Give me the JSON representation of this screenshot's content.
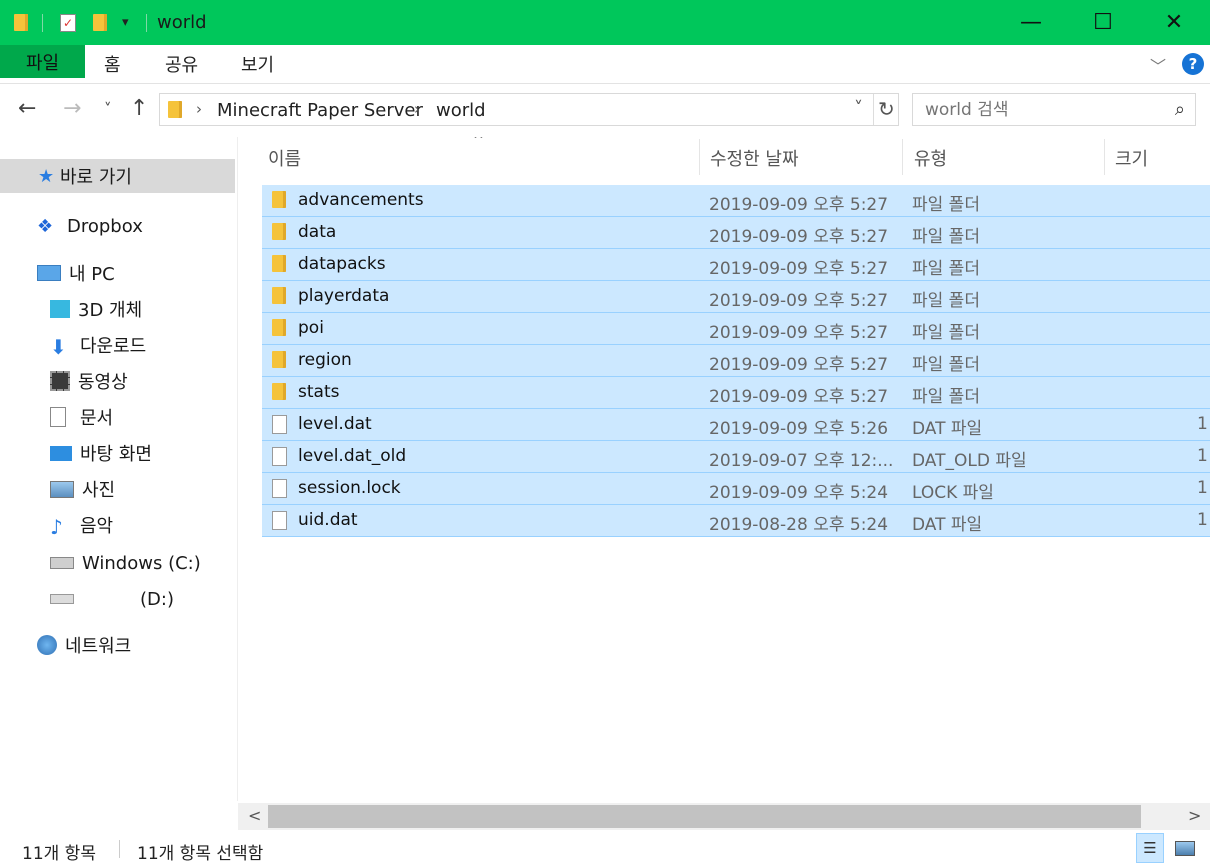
{
  "window": {
    "title": "world",
    "minimize": "—",
    "maximize": "☐",
    "close": "✕",
    "qa_dropdown": "▾"
  },
  "ribbon": {
    "file_tab": "파일",
    "tabs": [
      "홈",
      "공유",
      "보기"
    ],
    "expand": "﹀",
    "help": "?"
  },
  "nav": {
    "back": "←",
    "forward": "→",
    "recent": "˅",
    "up": "↑",
    "breadcrumb": [
      "Minecraft Paper Server",
      "world"
    ],
    "sep": "›",
    "dropdown": "˅",
    "refresh": "↻",
    "search_placeholder": "world 검색",
    "search_icon": "⌕"
  },
  "sidebar": {
    "quick_access": "바로 가기",
    "dropbox": "Dropbox",
    "this_pc": "내 PC",
    "items": [
      "3D 개체",
      "다운로드",
      "동영상",
      "문서",
      "바탕 화면",
      "사진",
      "음악",
      "Windows (C:)",
      "(D:)"
    ],
    "network": "네트워크"
  },
  "columns": {
    "name": "이름",
    "date": "수정한 날짜",
    "type": "유형",
    "size": "크기",
    "sort": "^"
  },
  "files": [
    {
      "name": "advancements",
      "date": "2019-09-09 오후 5:27",
      "type": "파일 폴더",
      "size": "",
      "kind": "folder"
    },
    {
      "name": "data",
      "date": "2019-09-09 오후 5:27",
      "type": "파일 폴더",
      "size": "",
      "kind": "folder"
    },
    {
      "name": "datapacks",
      "date": "2019-09-09 오후 5:27",
      "type": "파일 폴더",
      "size": "",
      "kind": "folder"
    },
    {
      "name": "playerdata",
      "date": "2019-09-09 오후 5:27",
      "type": "파일 폴더",
      "size": "",
      "kind": "folder"
    },
    {
      "name": "poi",
      "date": "2019-09-09 오후 5:27",
      "type": "파일 폴더",
      "size": "",
      "kind": "folder"
    },
    {
      "name": "region",
      "date": "2019-09-09 오후 5:27",
      "type": "파일 폴더",
      "size": "",
      "kind": "folder"
    },
    {
      "name": "stats",
      "date": "2019-09-09 오후 5:27",
      "type": "파일 폴더",
      "size": "",
      "kind": "folder"
    },
    {
      "name": "level.dat",
      "date": "2019-09-09 오후 5:26",
      "type": "DAT 파일",
      "size": "1",
      "kind": "file"
    },
    {
      "name": "level.dat_old",
      "date": "2019-09-07 오후 12:...",
      "type": "DAT_OLD 파일",
      "size": "1",
      "kind": "file"
    },
    {
      "name": "session.lock",
      "date": "2019-09-09 오후 5:24",
      "type": "LOCK 파일",
      "size": "1",
      "kind": "file"
    },
    {
      "name": "uid.dat",
      "date": "2019-08-28 오후 5:24",
      "type": "DAT 파일",
      "size": "1",
      "kind": "file"
    }
  ],
  "scroll": {
    "left": "<",
    "right": ">"
  },
  "status": {
    "count": "11개 항목",
    "selected": "11개 항목 선택함"
  },
  "colors": {
    "titlebar": "#00c75b",
    "selection": "#cce8ff",
    "folder": "#f5c33b"
  }
}
